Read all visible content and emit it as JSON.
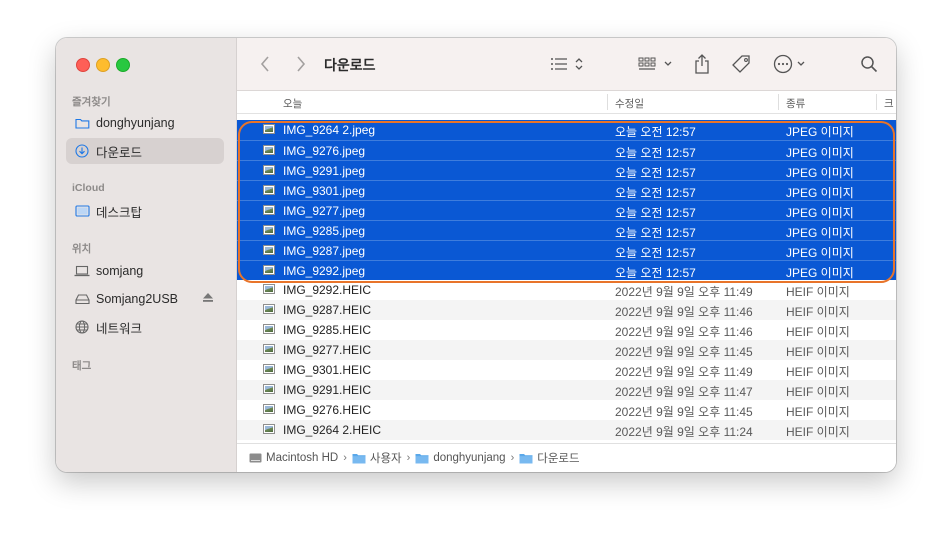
{
  "window": {
    "title": "다운로드"
  },
  "sidebar": {
    "favorites_header": "즐겨찾기",
    "favorites": [
      {
        "label": "donghyunjang",
        "icon": "folder-icon",
        "selected": false
      },
      {
        "label": "다운로드",
        "icon": "download-icon",
        "selected": true
      }
    ],
    "icloud_header": "iCloud",
    "icloud": [
      {
        "label": "데스크탑",
        "icon": "desktop-icon"
      }
    ],
    "locations_header": "위치",
    "locations": [
      {
        "label": "somjang",
        "icon": "laptop-icon"
      },
      {
        "label": "Somjang2USB",
        "icon": "drive-icon",
        "eject": true
      },
      {
        "label": "네트워크",
        "icon": "network-icon"
      }
    ],
    "tags_header": "태그"
  },
  "toolbar": {
    "back_icon": "chevron-left-icon",
    "forward_icon": "chevron-right-icon",
    "view_icon": "list-view-icon",
    "group_icon": "grid-group-icon",
    "share_icon": "share-icon",
    "tag_icon": "tag-icon",
    "more_icon": "ellipsis-circle-icon",
    "search_icon": "search-icon"
  },
  "columns": {
    "name": "오늘",
    "date": "수정일",
    "kind": "종류",
    "size": "크"
  },
  "files": [
    {
      "name": "IMG_9264 2.jpeg",
      "date": "오늘 오전 12:57",
      "kind": "JPEG 이미지",
      "selected": true
    },
    {
      "name": "IMG_9276.jpeg",
      "date": "오늘 오전 12:57",
      "kind": "JPEG 이미지",
      "selected": true
    },
    {
      "name": "IMG_9291.jpeg",
      "date": "오늘 오전 12:57",
      "kind": "JPEG 이미지",
      "selected": true
    },
    {
      "name": "IMG_9301.jpeg",
      "date": "오늘 오전 12:57",
      "kind": "JPEG 이미지",
      "selected": true
    },
    {
      "name": "IMG_9277.jpeg",
      "date": "오늘 오전 12:57",
      "kind": "JPEG 이미지",
      "selected": true
    },
    {
      "name": "IMG_9285.jpeg",
      "date": "오늘 오전 12:57",
      "kind": "JPEG 이미지",
      "selected": true
    },
    {
      "name": "IMG_9287.jpeg",
      "date": "오늘 오전 12:57",
      "kind": "JPEG 이미지",
      "selected": true
    },
    {
      "name": "IMG_9292.jpeg",
      "date": "오늘 오전 12:57",
      "kind": "JPEG 이미지",
      "selected": true
    },
    {
      "name": "IMG_9292.HEIC",
      "date": "2022년 9월 9일 오후 11:49",
      "kind": "HEIF 이미지",
      "selected": false
    },
    {
      "name": "IMG_9287.HEIC",
      "date": "2022년 9월 9일 오후 11:46",
      "kind": "HEIF 이미지",
      "selected": false
    },
    {
      "name": "IMG_9285.HEIC",
      "date": "2022년 9월 9일 오후 11:46",
      "kind": "HEIF 이미지",
      "selected": false
    },
    {
      "name": "IMG_9277.HEIC",
      "date": "2022년 9월 9일 오후 11:45",
      "kind": "HEIF 이미지",
      "selected": false
    },
    {
      "name": "IMG_9301.HEIC",
      "date": "2022년 9월 9일 오후 11:49",
      "kind": "HEIF 이미지",
      "selected": false
    },
    {
      "name": "IMG_9291.HEIC",
      "date": "2022년 9월 9일 오후 11:47",
      "kind": "HEIF 이미지",
      "selected": false
    },
    {
      "name": "IMG_9276.HEIC",
      "date": "2022년 9월 9일 오후 11:45",
      "kind": "HEIF 이미지",
      "selected": false
    },
    {
      "name": "IMG_9264 2.HEIC",
      "date": "2022년 9월 9일 오후 11:24",
      "kind": "HEIF 이미지",
      "selected": false
    }
  ],
  "pathbar": [
    {
      "label": "Macintosh HD",
      "icon": "hard-disk-icon"
    },
    {
      "label": "사용자",
      "icon": "folder-icon"
    },
    {
      "label": "donghyunjang",
      "icon": "folder-icon"
    },
    {
      "label": "다운로드",
      "icon": "folder-icon"
    }
  ],
  "colors": {
    "selection": "#0a58d4",
    "highlight_outline": "#e8742a",
    "sidebar_bg": "#e9e4e3",
    "accent": "#1e78e6"
  }
}
